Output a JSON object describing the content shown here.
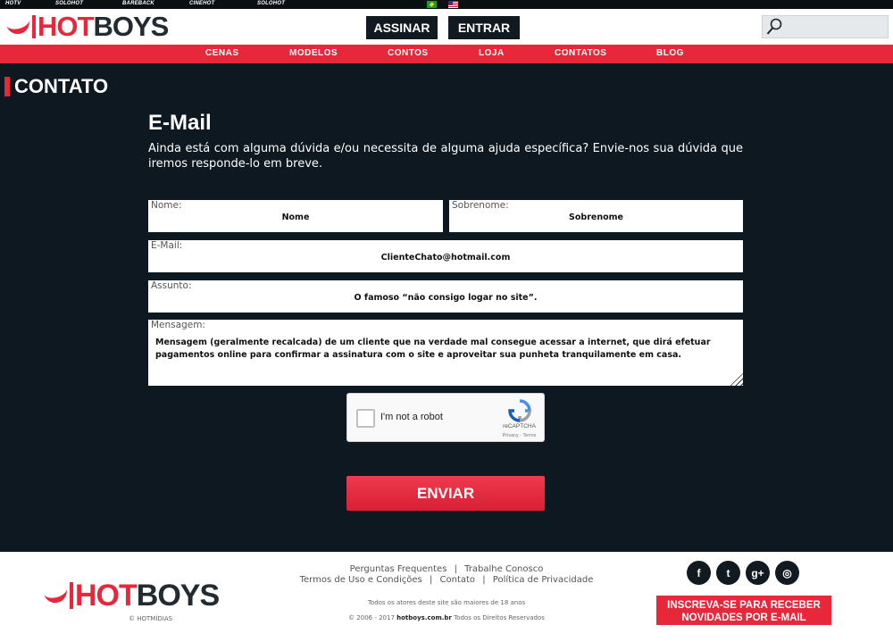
{
  "topbar": {
    "networks": [
      {
        "label": "HOTV"
      },
      {
        "label": "SOLOHOT"
      },
      {
        "label": "BAREBACK"
      },
      {
        "label": "CINEHOT"
      },
      {
        "label": "SOLOHOT"
      }
    ]
  },
  "header": {
    "logo_hot": "HOT",
    "logo_boys": "BOYS",
    "subscribe_label": "ASSINAR",
    "login_label": "ENTRAR",
    "search_placeholder": ""
  },
  "nav": {
    "items": [
      {
        "label": "CENAS"
      },
      {
        "label": "MODELOS"
      },
      {
        "label": "CONTOS"
      },
      {
        "label": "LOJA"
      },
      {
        "label": "CONTATOS"
      },
      {
        "label": "BLOG"
      }
    ]
  },
  "page": {
    "title": "CONTATO",
    "section_title": "E-Mail",
    "intro": "Ainda está com alguma dúvida e/ou necessita de alguma ajuda específica? Envie-nos sua dúvida que iremos responde-lo em breve."
  },
  "form": {
    "nome": {
      "label": "Nome:",
      "value": "Nome"
    },
    "sobrenome": {
      "label": "Sobrenome:",
      "value": "Sobrenome"
    },
    "email": {
      "label": "E-Mail:",
      "value": "ClienteChato@hotmail.com"
    },
    "assunto": {
      "label": "Assunto:",
      "value": "O famoso “não consigo logar no site”."
    },
    "mensagem": {
      "label": "Mensagem:",
      "value": "Mensagem (geralmente recalcada) de um cliente que na verdade mal consegue acessar a internet, que dirá efetuar pagamentos online para confirmar a assinatura com o site e aproveitar sua punheta tranquilamente em casa."
    },
    "captcha": {
      "label": "I'm not a robot",
      "brand": "reCAPTCHA",
      "terms": "Privacy - Terms"
    },
    "submit_label": "ENVIAR"
  },
  "footer": {
    "logo_hot": "HOT",
    "logo_boys": "BOYS",
    "brand_copyright": "© HOTMÍDIAS",
    "links_row1": [
      "Perguntas Frequentes",
      "Trabalhe Conosco"
    ],
    "links_row2": [
      "Termos de Uso e Condições",
      "Contato",
      "Política de Privacidade"
    ],
    "separator": "|",
    "age_notice": "Todos os atores deste site são maiores de 18 anos",
    "copyright_prefix": "© 2006 - 2017",
    "copyright_site": "hotboys.com.br",
    "copyright_suffix": "Todos os Direitos Reservados",
    "social": [
      {
        "name": "facebook-icon",
        "glyph": "f"
      },
      {
        "name": "twitter-icon",
        "glyph": "t"
      },
      {
        "name": "google-plus-icon",
        "glyph": "g+"
      },
      {
        "name": "instagram-icon",
        "glyph": "◎"
      }
    ],
    "newsletter_line1": "INSCREVA-SE PARA RECEBER",
    "newsletter_line2": "NOVIDADES POR E-MAIL"
  },
  "colors": {
    "accent": "#e8273b",
    "background": "#0d1820",
    "dark_button": "#111a20"
  }
}
